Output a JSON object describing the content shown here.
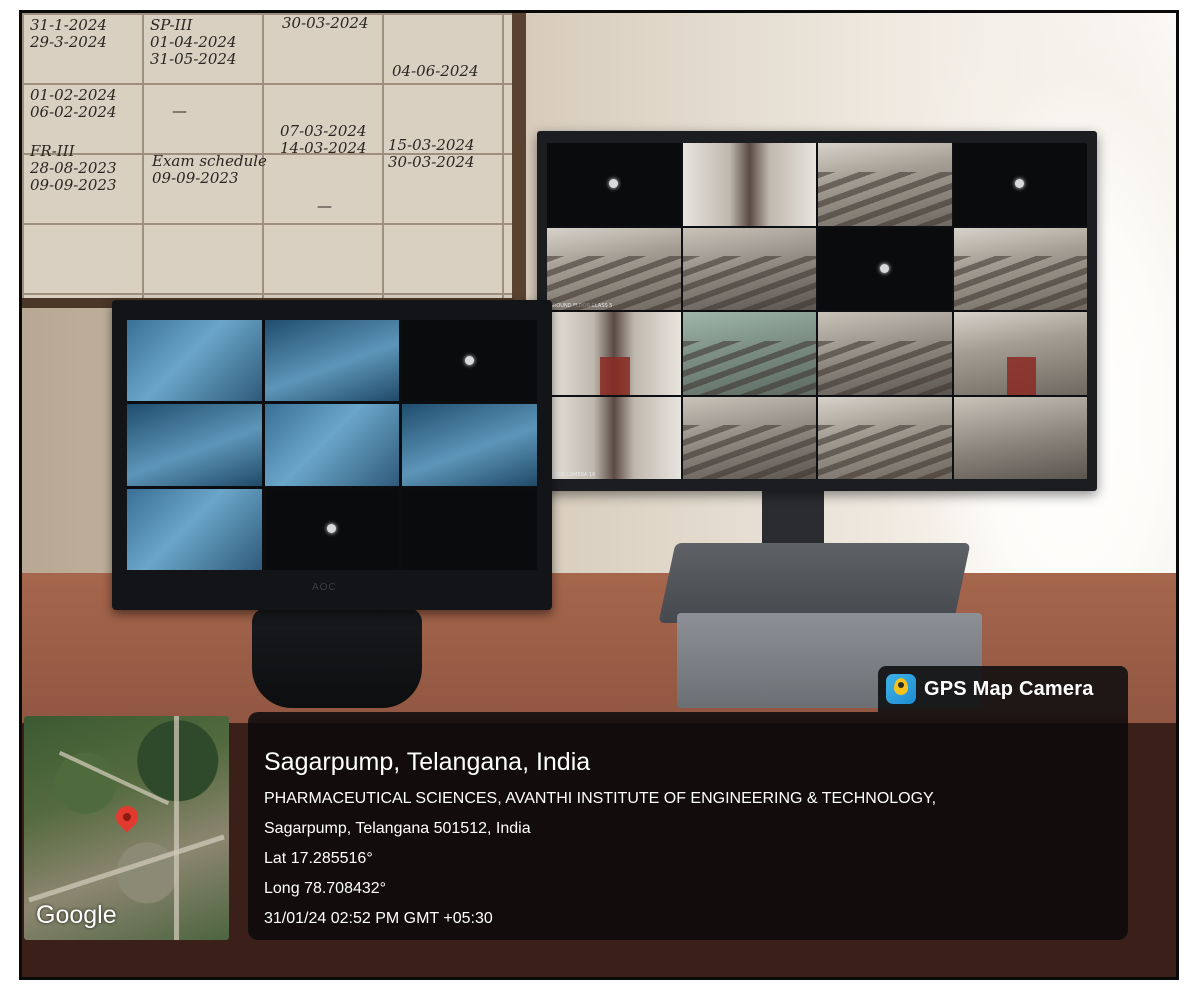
{
  "whiteboard": {
    "cells": [
      "31-1-2024\n29-3-2024",
      "SP-III\n01-04-2024\n31-05-2024",
      "30-03-2024",
      "04-06-2024",
      "01-02-2024\n06-02-2024",
      "07-03-2024\n14-03-2024",
      "15-03-2024\n30-03-2024",
      "FR-III\n28-08-2023\n09-09-2023",
      "Exam schedule\n09-09-2023",
      "—",
      "—"
    ]
  },
  "monitor_left": {
    "brand": "AOC",
    "tiles": [
      {
        "style": "t-blue"
      },
      {
        "style": "t-blue2"
      },
      {
        "style": "t-black",
        "cam": true
      },
      {
        "style": "t-blue2"
      },
      {
        "style": "t-blue"
      },
      {
        "style": "t-blue2"
      },
      {
        "style": "t-blue"
      },
      {
        "style": "t-black",
        "cam": true
      },
      {
        "style": "t-black"
      }
    ]
  },
  "monitor_right": {
    "tiles": [
      {
        "style": "t-black",
        "cam": true
      },
      {
        "style": "t-corr"
      },
      {
        "style": "t-class t-rows"
      },
      {
        "style": "t-black",
        "cam": true
      },
      {
        "style": "t-class t-rows",
        "label": "GROUND FLOOR CLASS 5"
      },
      {
        "style": "t-class2 t-rows"
      },
      {
        "style": "t-black",
        "cam": true
      },
      {
        "style": "t-class t-rows"
      },
      {
        "style": "t-corr t-red"
      },
      {
        "style": "t-green t-rows"
      },
      {
        "style": "t-class2 t-rows"
      },
      {
        "style": "t-class t-red"
      },
      {
        "style": "t-corr",
        "label": "ROOM CAMERA 16"
      },
      {
        "style": "t-class2 t-rows"
      },
      {
        "style": "t-class t-rows"
      },
      {
        "style": "t-class2"
      }
    ]
  },
  "gps_overlay": {
    "app_name": "GPS Map Camera",
    "app_icon": "map-pin-camera-icon",
    "title": "Sagarpump, Telangana, India",
    "address_line1": "PHARMACEUTICAL SCIENCES, AVANTHI INSTITUTE OF ENGINEERING & TECHNOLOGY,",
    "address_line2": "Sagarpump, Telangana 501512, India",
    "lat": "Lat 17.285516°",
    "long": "Long 78.708432°",
    "datetime": "31/01/24 02:52 PM GMT +05:30",
    "map_provider": "Google"
  },
  "colors": {
    "overlay_bg": "#0c0a0a",
    "overlay_text": "#ffffff",
    "pin": "#e33a2f"
  }
}
